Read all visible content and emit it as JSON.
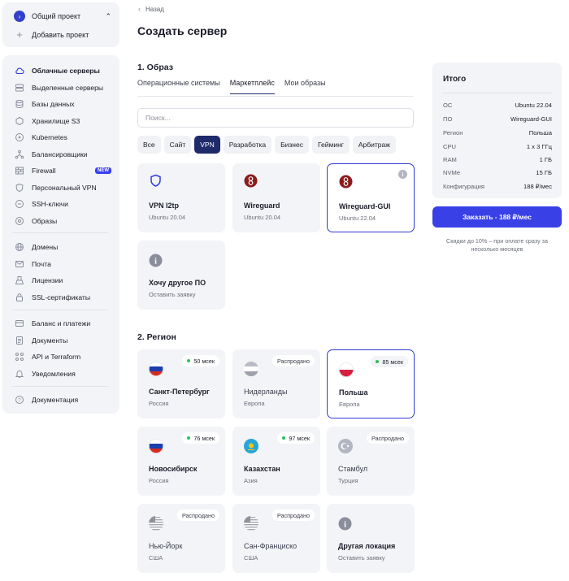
{
  "sidebar": {
    "project": {
      "name": "Общий проект",
      "add_label": "Добавить проект"
    },
    "items": [
      {
        "label": "Облачные серверы",
        "icon": "cloud-icon",
        "active": true
      },
      {
        "label": "Выделенные серверы",
        "icon": "server-icon"
      },
      {
        "label": "Базы данных",
        "icon": "database-icon"
      },
      {
        "label": "Хранилище S3",
        "icon": "storage-icon"
      },
      {
        "label": "Kubernetes",
        "icon": "kubernetes-icon"
      },
      {
        "label": "Балансировщики",
        "icon": "balancer-icon"
      },
      {
        "label": "Firewall",
        "icon": "firewall-icon",
        "badge": "NEW"
      },
      {
        "label": "Персональный VPN",
        "icon": "shield-icon"
      },
      {
        "label": "SSH-ключи",
        "icon": "key-icon"
      },
      {
        "label": "Образы",
        "icon": "image-icon"
      },
      {
        "label": "Домены",
        "icon": "globe-icon"
      },
      {
        "label": "Почта",
        "icon": "mail-icon"
      },
      {
        "label": "Лицензии",
        "icon": "license-icon"
      },
      {
        "label": "SSL-сертификаты",
        "icon": "lock-icon"
      },
      {
        "label": "Баланс и платежи",
        "icon": "wallet-icon"
      },
      {
        "label": "Документы",
        "icon": "document-icon"
      },
      {
        "label": "API и Terraform",
        "icon": "api-icon"
      },
      {
        "label": "Уведомления",
        "icon": "bell-icon"
      },
      {
        "label": "Документация",
        "icon": "help-icon"
      }
    ]
  },
  "header": {
    "back": "Назад",
    "title": "Создать сервер"
  },
  "image_section": {
    "title": "1. Образ",
    "tabs": [
      "Операционные системы",
      "Маркетплейс",
      "Мои образы"
    ],
    "active_tab": "Маркетплейс",
    "search_placeholder": "Поиск...",
    "chips": [
      "Все",
      "Сайт",
      "VPN",
      "Разработка",
      "Бизнес",
      "Гейминг",
      "Арбитраж"
    ],
    "active_chip": "VPN",
    "cards": [
      {
        "title": "VPN l2tp",
        "sub": "Ubuntu 20.04",
        "icon": "shield-icon"
      },
      {
        "title": "Wireguard",
        "sub": "Ubuntu 20.04",
        "icon": "wireguard-icon"
      },
      {
        "title": "Wireguard-GUI",
        "sub": "Ubuntu 22.04",
        "icon": "wireguard-icon",
        "selected": true
      },
      {
        "title": "Хочу другое ПО",
        "sub": "Оставить заявку",
        "icon": "info-icon"
      }
    ]
  },
  "region_section": {
    "title": "2. Регион",
    "cards": [
      {
        "title": "Санкт-Петербург",
        "sub": "Россия",
        "status": "50 мсек",
        "available": true,
        "flag": "ru"
      },
      {
        "title": "Нидерланды",
        "sub": "Европа",
        "status": "Распродано",
        "available": false,
        "flag": "nl"
      },
      {
        "title": "Польша",
        "sub": "Европа",
        "status": "85 мсек",
        "available": true,
        "flag": "pl",
        "selected": true
      },
      {
        "title": "Новосибирск",
        "sub": "Россия",
        "status": "76 мсек",
        "available": true,
        "flag": "ru"
      },
      {
        "title": "Казахстан",
        "sub": "Азия",
        "status": "97 мсек",
        "available": true,
        "flag": "kz"
      },
      {
        "title": "Стамбул",
        "sub": "Турция",
        "status": "Распродано",
        "available": false,
        "flag": "tr"
      },
      {
        "title": "Нью-Йорк",
        "sub": "США",
        "status": "Распродано",
        "available": false,
        "flag": "us"
      },
      {
        "title": "Сан-Франциско",
        "sub": "США",
        "status": "Распродано",
        "available": false,
        "flag": "us"
      },
      {
        "title": "Другая локация",
        "sub": "Оставить заявку",
        "status": "",
        "available": true,
        "flag": "info"
      }
    ]
  },
  "summary": {
    "title": "Итого",
    "rows": [
      {
        "k": "ОС",
        "v": "Ubuntu 22.04"
      },
      {
        "k": "ПО",
        "v": "Wireguard-GUI"
      },
      {
        "k": "Регион",
        "v": "Польша"
      },
      {
        "k": "CPU",
        "v": "1 x 3 ГГц"
      },
      {
        "k": "RAM",
        "v": "1 ГБ"
      },
      {
        "k": "NVMe",
        "v": "15 ГБ"
      },
      {
        "k": "Конфигурация",
        "v": "188 ₽/мес"
      }
    ],
    "order_button": "Заказать - 188 ₽/мес",
    "discount": "Скидки до 10% – при оплате сразу за несколько месяцев"
  },
  "colors": {
    "accent": "#3940e6",
    "dark": "#1f2a6a",
    "ping": "#2fbf5a"
  }
}
